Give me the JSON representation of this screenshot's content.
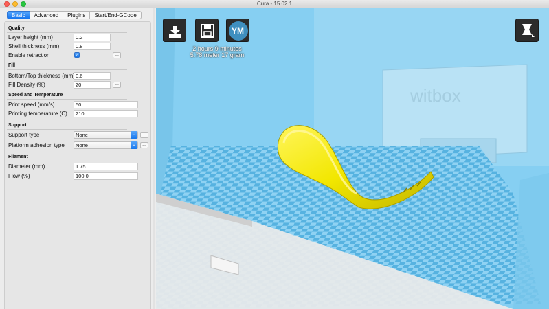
{
  "window": {
    "title": "Cura - 15.02.1"
  },
  "tabs": [
    {
      "label": "Basic",
      "active": true
    },
    {
      "label": "Advanced",
      "active": false
    },
    {
      "label": "Plugins",
      "active": false
    },
    {
      "label": "Start/End-GCode",
      "active": false
    }
  ],
  "quality": {
    "title": "Quality",
    "layer_height_label": "Layer height (mm)",
    "layer_height": "0.2",
    "shell_thickness_label": "Shell thickness (mm)",
    "shell_thickness": "0.8",
    "retraction_label": "Enable retraction",
    "retraction_checked": true
  },
  "fill": {
    "title": "Fill",
    "bottom_top_label": "Bottom/Top thickness (mm)",
    "bottom_top": "0.6",
    "density_label": "Fill Density (%)",
    "density": "20"
  },
  "speed": {
    "title": "Speed and Temperature",
    "print_speed_label": "Print speed (mm/s)",
    "print_speed": "50",
    "temp_label": "Printing temperature (C)",
    "temp": "210"
  },
  "support": {
    "title": "Support",
    "type_label": "Support type",
    "type_value": "None",
    "adhesion_label": "Platform adhesion type",
    "adhesion_value": "None"
  },
  "filament": {
    "title": "Filament",
    "diameter_label": "Diameter (mm)",
    "diameter": "1.75",
    "flow_label": "Flow (%)",
    "flow": "100.0"
  },
  "viewport": {
    "print_time": "2 hours 9 minutes",
    "print_material": "5.78 meter 17 gram",
    "ym_label": "YM",
    "machine_logo": "witbox",
    "model_color": "#f6f000",
    "bed_color": "#5fb8e6"
  },
  "icons": {
    "load": "load-model-icon",
    "save": "save-toolpath-icon",
    "ym": "youmagine-icon",
    "view": "view-mode-icon"
  }
}
